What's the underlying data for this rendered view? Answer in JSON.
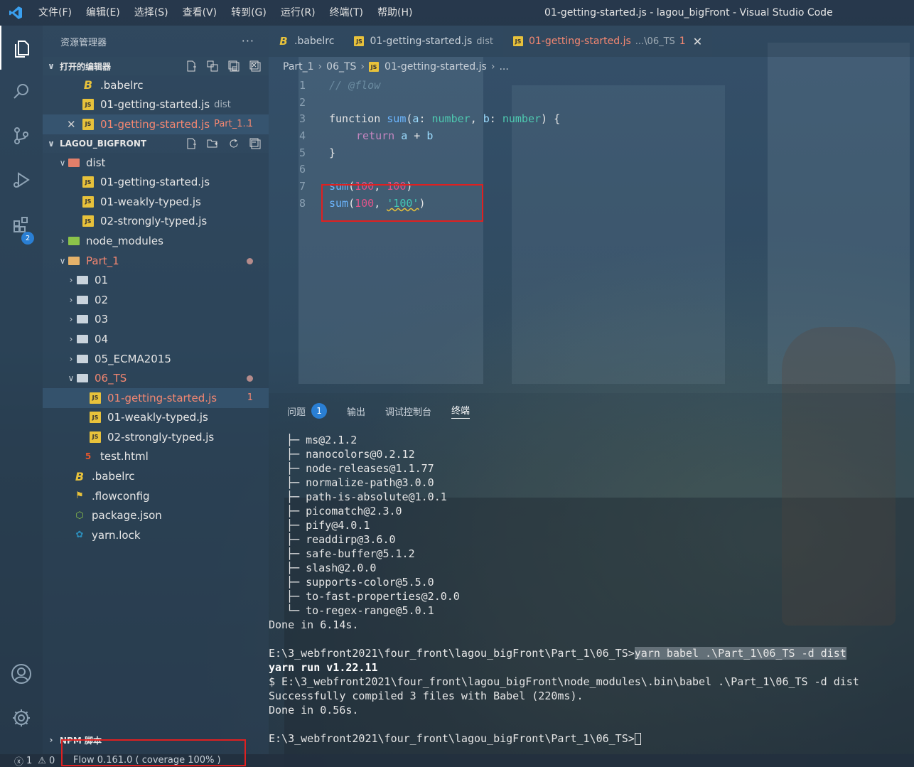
{
  "titlebar": {
    "menu": [
      "文件(F)",
      "编辑(E)",
      "选择(S)",
      "查看(V)",
      "转到(G)",
      "运行(R)",
      "终端(T)",
      "帮助(H)"
    ],
    "window_title": "01-getting-started.js - lagou_bigFront - Visual Studio Code"
  },
  "activity": {
    "extensions_badge": "2"
  },
  "sidebar": {
    "title": "资源管理器",
    "more": "···",
    "open_editors": {
      "label": "打开的编辑器",
      "items": [
        {
          "name": ".babelrc",
          "desc": ""
        },
        {
          "name": "01-getting-started.js",
          "desc": "dist"
        },
        {
          "name": "01-getting-started.js",
          "desc": "Part_1...",
          "badge": "1"
        }
      ]
    },
    "workspace": {
      "label": "LAGOU_BIGFRONT",
      "items": [
        {
          "name": "dist"
        },
        {
          "name": "01-getting-started.js"
        },
        {
          "name": "01-weakly-typed.js"
        },
        {
          "name": "02-strongly-typed.js"
        },
        {
          "name": "node_modules"
        },
        {
          "name": "Part_1"
        },
        {
          "name": "01"
        },
        {
          "name": "02"
        },
        {
          "name": "03"
        },
        {
          "name": "04"
        },
        {
          "name": "05_ECMA2015"
        },
        {
          "name": "06_TS"
        },
        {
          "name": "01-getting-started.js",
          "badge": "1"
        },
        {
          "name": "01-weakly-typed.js"
        },
        {
          "name": "02-strongly-typed.js"
        },
        {
          "name": "test.html"
        },
        {
          "name": ".babelrc"
        },
        {
          "name": ".flowconfig"
        },
        {
          "name": "package.json"
        },
        {
          "name": "yarn.lock"
        }
      ]
    },
    "npm_scripts": "NPM 脚本"
  },
  "tabs": [
    {
      "label": ".babelrc",
      "desc": ""
    },
    {
      "label": "01-getting-started.js",
      "desc": "dist"
    },
    {
      "label": "01-getting-started.js",
      "desc": "...\\06_TS",
      "badge": "1"
    }
  ],
  "breadcrumb": [
    "Part_1",
    "06_TS",
    "01-getting-started.js",
    "..."
  ],
  "editor": {
    "line_numbers": [
      "1",
      "2",
      "3",
      "4",
      "5",
      "6",
      "7",
      "8"
    ],
    "line1": "// @flow",
    "line3": {
      "kw": "function",
      "fn": "sum",
      "open": "(",
      "p1": "a",
      "colon1": ": ",
      "t1": "number",
      "comma": ", ",
      "p2": "b",
      "colon2": ": ",
      "t2": "number",
      "close": ") {"
    },
    "line4": {
      "kw": "return",
      "expr_a": "a",
      "op": " + ",
      "expr_b": "b"
    },
    "line5": "}",
    "line7": {
      "fn": "sum",
      "open": "(",
      "n1": "100",
      "comma": ", ",
      "n2": "100",
      "close": ")"
    },
    "line8": {
      "fn": "sum",
      "open": "(",
      "n1": "100",
      "comma": ", ",
      "s": "'100'",
      "close": ")"
    }
  },
  "panel": {
    "tabs": [
      "问题",
      "输出",
      "调试控制台",
      "终端"
    ],
    "problems_count": "1",
    "terminal_lines": [
      "├─ ms@2.1.2",
      "├─ nanocolors@0.2.12",
      "├─ node-releases@1.1.77",
      "├─ normalize-path@3.0.0",
      "├─ path-is-absolute@1.0.1",
      "├─ picomatch@2.3.0",
      "├─ pify@4.0.1",
      "├─ readdirp@3.6.0",
      "├─ safe-buffer@5.1.2",
      "├─ slash@2.0.0",
      "├─ supports-color@5.5.0",
      "├─ to-fast-properties@2.0.0",
      "└─ to-regex-range@5.0.1",
      "Done in 6.14s.",
      ""
    ],
    "prompt1": "E:\\3_webfront2021\\four_front\\lagou_bigFront\\Part_1\\06_TS>",
    "command1": "yarn babel .\\Part_1\\06_TS -d dist",
    "yarn_run": "yarn run v1.22.11",
    "babel_cmd": "$ E:\\3_webfront2021\\four_front\\lagou_bigFront\\node_modules\\.bin\\babel .\\Part_1\\06_TS -d dist",
    "compiled": "Successfully compiled 3 files with Babel (220ms).",
    "done2": "Done in 0.56s.",
    "prompt2": "E:\\3_webfront2021\\four_front\\lagou_bigFront\\Part_1\\06_TS>"
  },
  "statusbar": {
    "errors": "1",
    "warnings": "0",
    "flow": "Flow 0.161.0 ( coverage 100% )"
  },
  "colors": {
    "accent": "#2a7fd4",
    "error": "#f48771",
    "highlight_box": "#e02020"
  }
}
